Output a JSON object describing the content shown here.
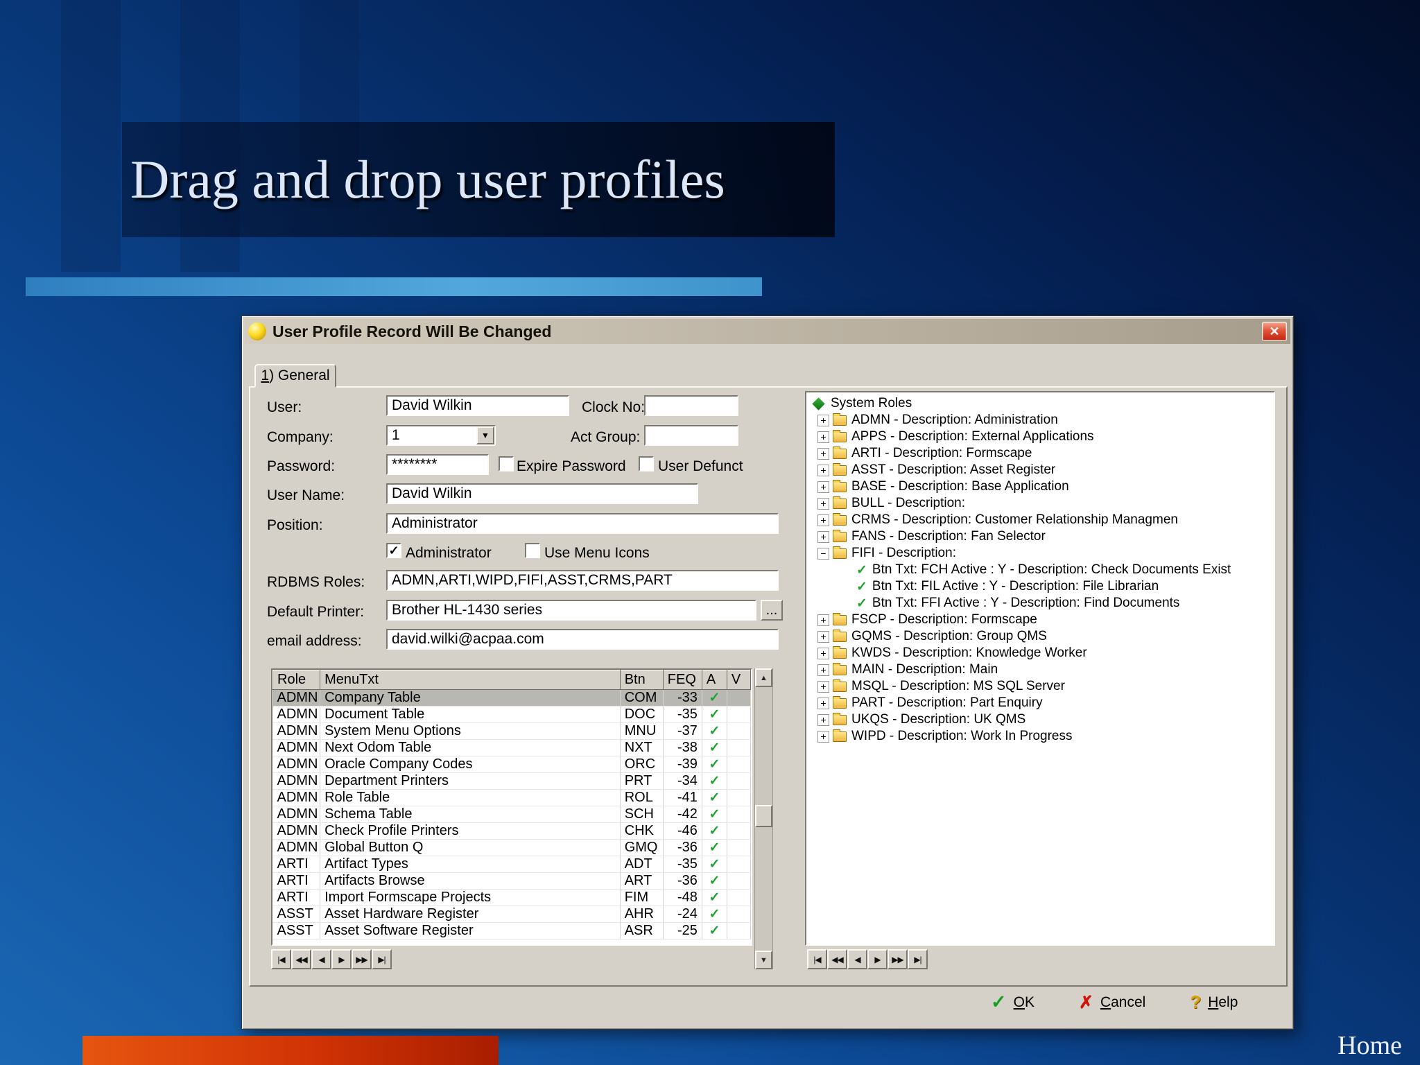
{
  "slide": {
    "title": "Drag and drop user profiles",
    "home": "Home"
  },
  "colors": {
    "check_green": "#1fa32e",
    "cancel_red": "#cf1408",
    "help_gold": "#d9a410",
    "accent_cyan": "#52a8dc",
    "accent_orange": "#d13305"
  },
  "dialog": {
    "title": "User Profile Record Will Be Changed",
    "close": "✕",
    "tab": "1) General",
    "check_glyph": "✓",
    "scrollbar": {
      "up": "▲",
      "down": "▼"
    },
    "form": {
      "user_label": "User:",
      "user_value": "David Wilkin",
      "clock_label": "Clock No:",
      "clock_value": "",
      "company_label": "Company:",
      "company_value": "1",
      "company_drop": "▼",
      "act_group_label": "Act Group:",
      "act_group_value": "",
      "password_label": "Password:",
      "password_value": "********",
      "expire_label": "Expire Password",
      "expire_checked": false,
      "defunct_label": "User Defunct",
      "defunct_checked": false,
      "user_name_label": "User Name:",
      "user_name_value": "David Wilkin",
      "position_label": "Position:",
      "position_value": "Administrator",
      "admin_label": "Administrator",
      "admin_checked": true,
      "menu_icons_label": "Use Menu Icons",
      "menu_icons_checked": false,
      "rdbms_label": "RDBMS Roles:",
      "rdbms_value": "ADMN,ARTI,WIPD,FIFI,ASST,CRMS,PART",
      "printer_label": "Default Printer:",
      "printer_value": "Brother HL-1430 series",
      "printer_browse": "...",
      "email_label": "email address:",
      "email_value": "david.wilki@acpaa.com"
    },
    "grid": {
      "columns": [
        "Role",
        "MenuTxt",
        "Btn",
        "FEQ",
        "A",
        "V"
      ],
      "selected_row": 0,
      "rows": [
        [
          "ADMN",
          "Company Table",
          "COM",
          "-33",
          true
        ],
        [
          "ADMN",
          "Document Table",
          "DOC",
          "-35",
          true
        ],
        [
          "ADMN",
          "System Menu Options",
          "MNU",
          "-37",
          true
        ],
        [
          "ADMN",
          "Next Odom Table",
          "NXT",
          "-38",
          true
        ],
        [
          "ADMN",
          "Oracle Company Codes",
          "ORC",
          "-39",
          true
        ],
        [
          "ADMN",
          "Department Printers",
          "PRT",
          "-34",
          true
        ],
        [
          "ADMN",
          "Role Table",
          "ROL",
          "-41",
          true
        ],
        [
          "ADMN",
          "Schema Table",
          "SCH",
          "-42",
          true
        ],
        [
          "ADMN",
          "Check Profile Printers",
          "CHK",
          "-46",
          true
        ],
        [
          "ADMN",
          "Global Button Q",
          "GMQ",
          "-36",
          true
        ],
        [
          "ARTI",
          "Artifact Types",
          "ADT",
          "-35",
          true
        ],
        [
          "ARTI",
          "Artifacts Browse",
          "ART",
          "-36",
          true
        ],
        [
          "ARTI",
          "Import Formscape Projects",
          "FIM",
          "-48",
          true
        ],
        [
          "ASST",
          "Asset Hardware Register",
          "AHR",
          "-24",
          true
        ],
        [
          "ASST",
          "Asset Software Register",
          "ASR",
          "-25",
          true
        ]
      ]
    },
    "navigator_buttons": [
      "|◀",
      "◀◀",
      "◀",
      "▶",
      "▶▶",
      "▶|"
    ],
    "tree": {
      "root": "System Roles",
      "items": [
        {
          "t": "folder",
          "exp": "+",
          "label": "ADMN - Description:  Administration"
        },
        {
          "t": "folder",
          "exp": "+",
          "label": "APPS - Description:  External Applications"
        },
        {
          "t": "folder",
          "exp": "+",
          "label": "ARTI - Description:  Formscape"
        },
        {
          "t": "folder",
          "exp": "+",
          "label": "ASST - Description:  Asset Register"
        },
        {
          "t": "folder",
          "exp": "+",
          "label": "BASE - Description:  Base Application"
        },
        {
          "t": "folder",
          "exp": "+",
          "label": "BULL - Description:"
        },
        {
          "t": "folder",
          "exp": "+",
          "label": "CRMS - Description:  Customer Relationship Managmen"
        },
        {
          "t": "folder",
          "exp": "+",
          "label": "FANS - Description:  Fan Selector"
        },
        {
          "t": "folder",
          "exp": "−",
          "label": "FIFI - Description:"
        },
        {
          "t": "leaf",
          "label": "Btn Txt: FCH Active : Y - Description: Check Documents Exist"
        },
        {
          "t": "leaf",
          "label": "Btn Txt: FIL Active : Y - Description: File Librarian"
        },
        {
          "t": "leaf",
          "label": "Btn Txt: FFI Active : Y - Description: Find Documents"
        },
        {
          "t": "folder",
          "exp": "+",
          "label": "FSCP - Description:  Formscape"
        },
        {
          "t": "folder",
          "exp": "+",
          "label": "GQMS - Description:  Group QMS"
        },
        {
          "t": "folder",
          "exp": "+",
          "label": "KWDS - Description:  Knowledge Worker"
        },
        {
          "t": "folder",
          "exp": "+",
          "label": "MAIN - Description:  Main"
        },
        {
          "t": "folder",
          "exp": "+",
          "label": "MSQL - Description:  MS SQL Server"
        },
        {
          "t": "folder",
          "exp": "+",
          "label": "PART - Description:  Part Enquiry"
        },
        {
          "t": "folder",
          "exp": "+",
          "label": "UKQS - Description:  UK QMS"
        },
        {
          "t": "folder",
          "exp": "+",
          "label": "WIPD - Description:  Work In Progress"
        }
      ]
    },
    "actions": [
      {
        "icon": "check",
        "glyph": "✓",
        "label": "OK"
      },
      {
        "icon": "cross",
        "glyph": "✗",
        "label": "Cancel"
      },
      {
        "icon": "help",
        "glyph": "?",
        "label": "Help"
      }
    ]
  }
}
